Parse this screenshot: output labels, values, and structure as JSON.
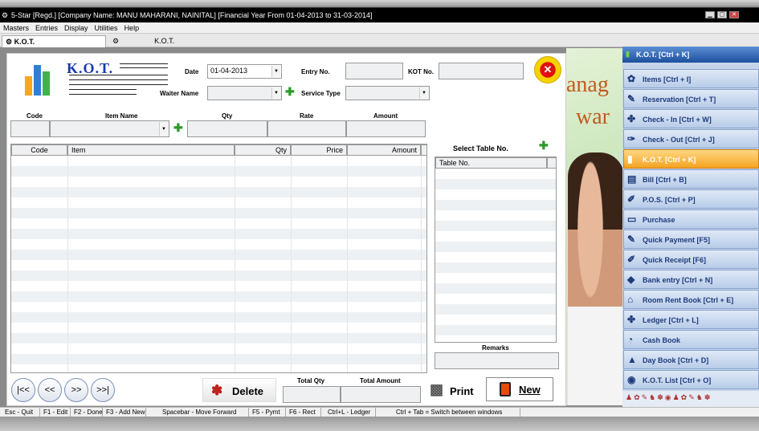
{
  "window": {
    "title": "5-Star [Regd.] [Company Name: MANU MAHARANI, NAINITAL] [Financial Year From 01-04-2013 to 31-03-2014]"
  },
  "menu": [
    "Masters",
    "Entries",
    "Display",
    "Utilities",
    "Help"
  ],
  "tabs": [
    {
      "label": "K.O.T."
    },
    {
      "label": "K.O.T."
    }
  ],
  "form": {
    "title": "K.O.T.",
    "date_label": "Date",
    "date_value": "01-04-2013",
    "entry_label": "Entry No.",
    "kot_label": "KOT No.",
    "waiter_label": "Waiter Name",
    "service_label": "Service Type",
    "entry_cols": [
      "Code",
      "Item Name",
      "Qty",
      "Rate",
      "Amount"
    ],
    "grid_cols": [
      "Code",
      "Item",
      "Qty",
      "Price",
      "Amount"
    ],
    "select_table": "Select Table No.",
    "table_col": "Table No.",
    "remarks": "Remarks",
    "total_qty": "Total Qty",
    "total_amount": "Total Amount"
  },
  "nav": [
    "|<<",
    "<<",
    ">>",
    ">>|"
  ],
  "buttons": {
    "delete": "Delete",
    "print": "Print",
    "new": "New"
  },
  "ad": {
    "line1": "anag",
    "line2": "war"
  },
  "sidebar": {
    "header": "K.O.T. [Ctrl + K]",
    "items": [
      {
        "label": "Items [Ctrl + I]",
        "icon": "✿"
      },
      {
        "label": "Reservation [Ctrl + T]",
        "icon": "✎"
      },
      {
        "label": "Check - In [Ctrl + W]",
        "icon": "✤"
      },
      {
        "label": "Check - Out [Ctrl + J]",
        "icon": "✑"
      },
      {
        "label": "K.O.T. [Ctrl + K]",
        "icon": "▮"
      },
      {
        "label": "Bill [Ctrl + B]",
        "icon": "▤"
      },
      {
        "label": "P.O.S. [Ctrl + P]",
        "icon": "✐"
      },
      {
        "label": "Purchase",
        "icon": "▭"
      },
      {
        "label": "Quick Payment [F5]",
        "icon": "✎"
      },
      {
        "label": "Quick Receipt [F6]",
        "icon": "✐"
      },
      {
        "label": "Bank entry [Ctrl + N]",
        "icon": "◆"
      },
      {
        "label": "Room Rent Book [Ctrl + E]",
        "icon": "⌂"
      },
      {
        "label": "Ledger [Ctrl + L]",
        "icon": "✤"
      },
      {
        "label": "Cash Book",
        "icon": "◔"
      },
      {
        "label": "Day Book [Ctrl + D]",
        "icon": "▲"
      },
      {
        "label": "K.O.T. List [Ctrl + O]",
        "icon": "◉"
      }
    ]
  },
  "status": [
    "Esc - Quit",
    "F1 - Edit",
    "F2 - Done",
    "F3 - Add New",
    "Spacebar - Move Forward",
    "F5 - Pymt",
    "F6 - Rect",
    "Ctrl+L - Ledger",
    "Ctrl + Tab = Switch between windows"
  ]
}
